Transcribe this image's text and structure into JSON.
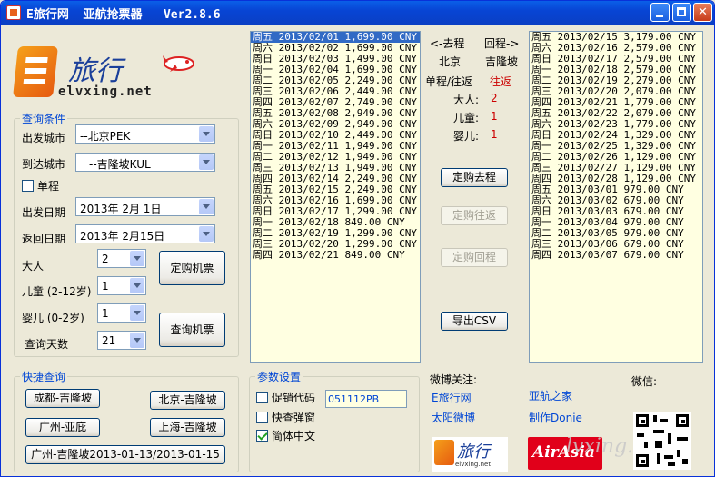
{
  "window": {
    "title": "E旅行网  亚航抢票器   Ver2.8.6"
  },
  "logo": {
    "cn": "旅行",
    "en": "elvxing.net"
  },
  "query": {
    "title": "查询条件",
    "from_label": "出发城市",
    "from_value": "--北京PEK",
    "to_label": "到达城市",
    "to_value": "--吉隆坡KUL",
    "oneway_label": "单程",
    "depart_label": "出发日期",
    "depart_value": "2013年  2月 1日",
    "return_label": "返回日期",
    "return_value": "2013年  2月15日",
    "adult_label": "大人",
    "adult_value": "2",
    "child_label": "儿童 (2-12岁)",
    "child_value": "1",
    "infant_label": "婴儿 (0-2岁)",
    "infant_value": "1",
    "days_label": "查询天数",
    "days_value": "21",
    "book_button": "定购机票",
    "search_button": "查询机票"
  },
  "quick": {
    "title": "快捷查询",
    "buttons": [
      "成都-吉隆坡",
      "北京-吉隆坡",
      "广州-亚庇",
      "上海-吉隆坡",
      "广州-吉隆坡2013-01-13/2013-01-15"
    ]
  },
  "params": {
    "title": "参数设置",
    "promo_label": "促销代码",
    "promo_value": "051112PB",
    "popup_label": "快查弹窗",
    "chinese_label": "简体中文"
  },
  "outbound_list": [
    "周五 2013/02/01 1,699.00 CNY",
    "周六 2013/02/02 1,699.00 CNY",
    "周日 2013/02/03 1,499.00 CNY",
    "周一 2013/02/04 1,699.00 CNY",
    "周二 2013/02/05 2,249.00 CNY",
    "周三 2013/02/06 2,449.00 CNY",
    "周四 2013/02/07 2,749.00 CNY",
    "周五 2013/02/08 2,949.00 CNY",
    "周六 2013/02/09 2,949.00 CNY",
    "周日 2013/02/10 2,449.00 CNY",
    "周一 2013/02/11 1,949.00 CNY",
    "周二 2013/02/12 1,949.00 CNY",
    "周三 2013/02/13 1,949.00 CNY",
    "周四 2013/02/14 2,249.00 CNY",
    "周五 2013/02/15 2,249.00 CNY",
    "周六 2013/02/16 1,699.00 CNY",
    "周日 2013/02/17 1,299.00 CNY",
    "周一 2013/02/18 849.00 CNY",
    "周二 2013/02/19 1,299.00 CNY",
    "周三 2013/02/20 1,299.00 CNY",
    "周四 2013/02/21 849.00 CNY"
  ],
  "return_list": [
    "周五 2013/02/15 3,179.00 CNY",
    "周六 2013/02/16 2,579.00 CNY",
    "周日 2013/02/17 2,579.00 CNY",
    "周一 2013/02/18 2,579.00 CNY",
    "周二 2013/02/19 2,279.00 CNY",
    "周三 2013/02/20 2,079.00 CNY",
    "周四 2013/02/21 1,779.00 CNY",
    "周五 2013/02/22 2,079.00 CNY",
    "周六 2013/02/23 1,779.00 CNY",
    "周日 2013/02/24 1,329.00 CNY",
    "周一 2013/02/25 1,329.00 CNY",
    "周二 2013/02/26 1,129.00 CNY",
    "周三 2013/02/27 1,129.00 CNY",
    "周四 2013/02/28 1,129.00 CNY",
    "周五 2013/03/01 979.00 CNY",
    "周六 2013/03/02 679.00 CNY",
    "周日 2013/03/03 679.00 CNY",
    "周一 2013/03/04 979.00 CNY",
    "周二 2013/03/05 979.00 CNY",
    "周三 2013/03/06 679.00 CNY",
    "周四 2013/03/07 679.00 CNY"
  ],
  "summary": {
    "outbound_header": "<-去程",
    "return_header": "回程->",
    "from_city": "北京",
    "to_city": "吉隆坡",
    "trip_label": "单程/往返",
    "trip_value": "往返",
    "adult_label": "大人:",
    "adult_value": "2",
    "child_label": "儿童:",
    "child_value": "1",
    "infant_label": "婴儿:",
    "infant_value": "1",
    "book_outbound": "定购去程",
    "book_round": "定购往返",
    "book_return": "定购回程",
    "export_csv": "导出CSV"
  },
  "social": {
    "weibo_label": "微博关注:",
    "weixin_label": "微信:",
    "links": [
      "E旅行网",
      "亚航之家",
      "太阳微博",
      "制作Donie"
    ]
  },
  "brand": {
    "small_logo_cn": "旅行",
    "small_logo_en": "elvxing.net",
    "airasia": "AirAsia",
    "watermark": "lvxing.net"
  }
}
